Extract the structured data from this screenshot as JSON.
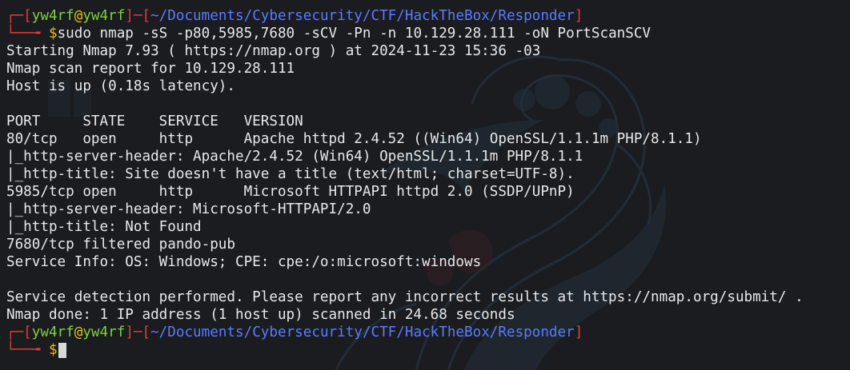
{
  "colors": {
    "background": "#1a1c20",
    "prompt_frame": "#e43b3b",
    "user": "#7fd13b",
    "host": "#7fd13b",
    "at_sign": "#e8c200",
    "path": "#5a7bff",
    "text": "#e8e8e8"
  },
  "prompt1": {
    "user": "yw4rf",
    "at": "@",
    "host": "yw4rf",
    "path": "~/Documents/Cybersecurity/CTF/HackTheBox/Responder",
    "command": "sudo nmap -sS -p80,5985,7680 -sCV -Pn -n 10.129.28.111 -oN PortScanSCV"
  },
  "output": [
    "Starting Nmap 7.93 ( https://nmap.org ) at 2024-11-23 15:36 -03",
    "Nmap scan report for 10.129.28.111",
    "Host is up (0.18s latency).",
    "",
    "PORT     STATE    SERVICE   VERSION",
    "80/tcp   open     http      Apache httpd 2.4.52 ((Win64) OpenSSL/1.1.1m PHP/8.1.1)",
    "|_http-server-header: Apache/2.4.52 (Win64) OpenSSL/1.1.1m PHP/8.1.1",
    "|_http-title: Site doesn't have a title (text/html; charset=UTF-8).",
    "5985/tcp open     http      Microsoft HTTPAPI httpd 2.0 (SSDP/UPnP)",
    "|_http-server-header: Microsoft-HTTPAPI/2.0",
    "|_http-title: Not Found",
    "7680/tcp filtered pando-pub",
    "Service Info: OS: Windows; CPE: cpe:/o:microsoft:windows",
    "",
    "Service detection performed. Please report any incorrect results at https://nmap.org/submit/ .",
    "Nmap done: 1 IP address (1 host up) scanned in 24.68 seconds"
  ],
  "prompt2": {
    "user": "yw4rf",
    "at": "@",
    "host": "yw4rf",
    "path": "~/Documents/Cybersecurity/CTF/HackTheBox/Responder",
    "command": ""
  }
}
